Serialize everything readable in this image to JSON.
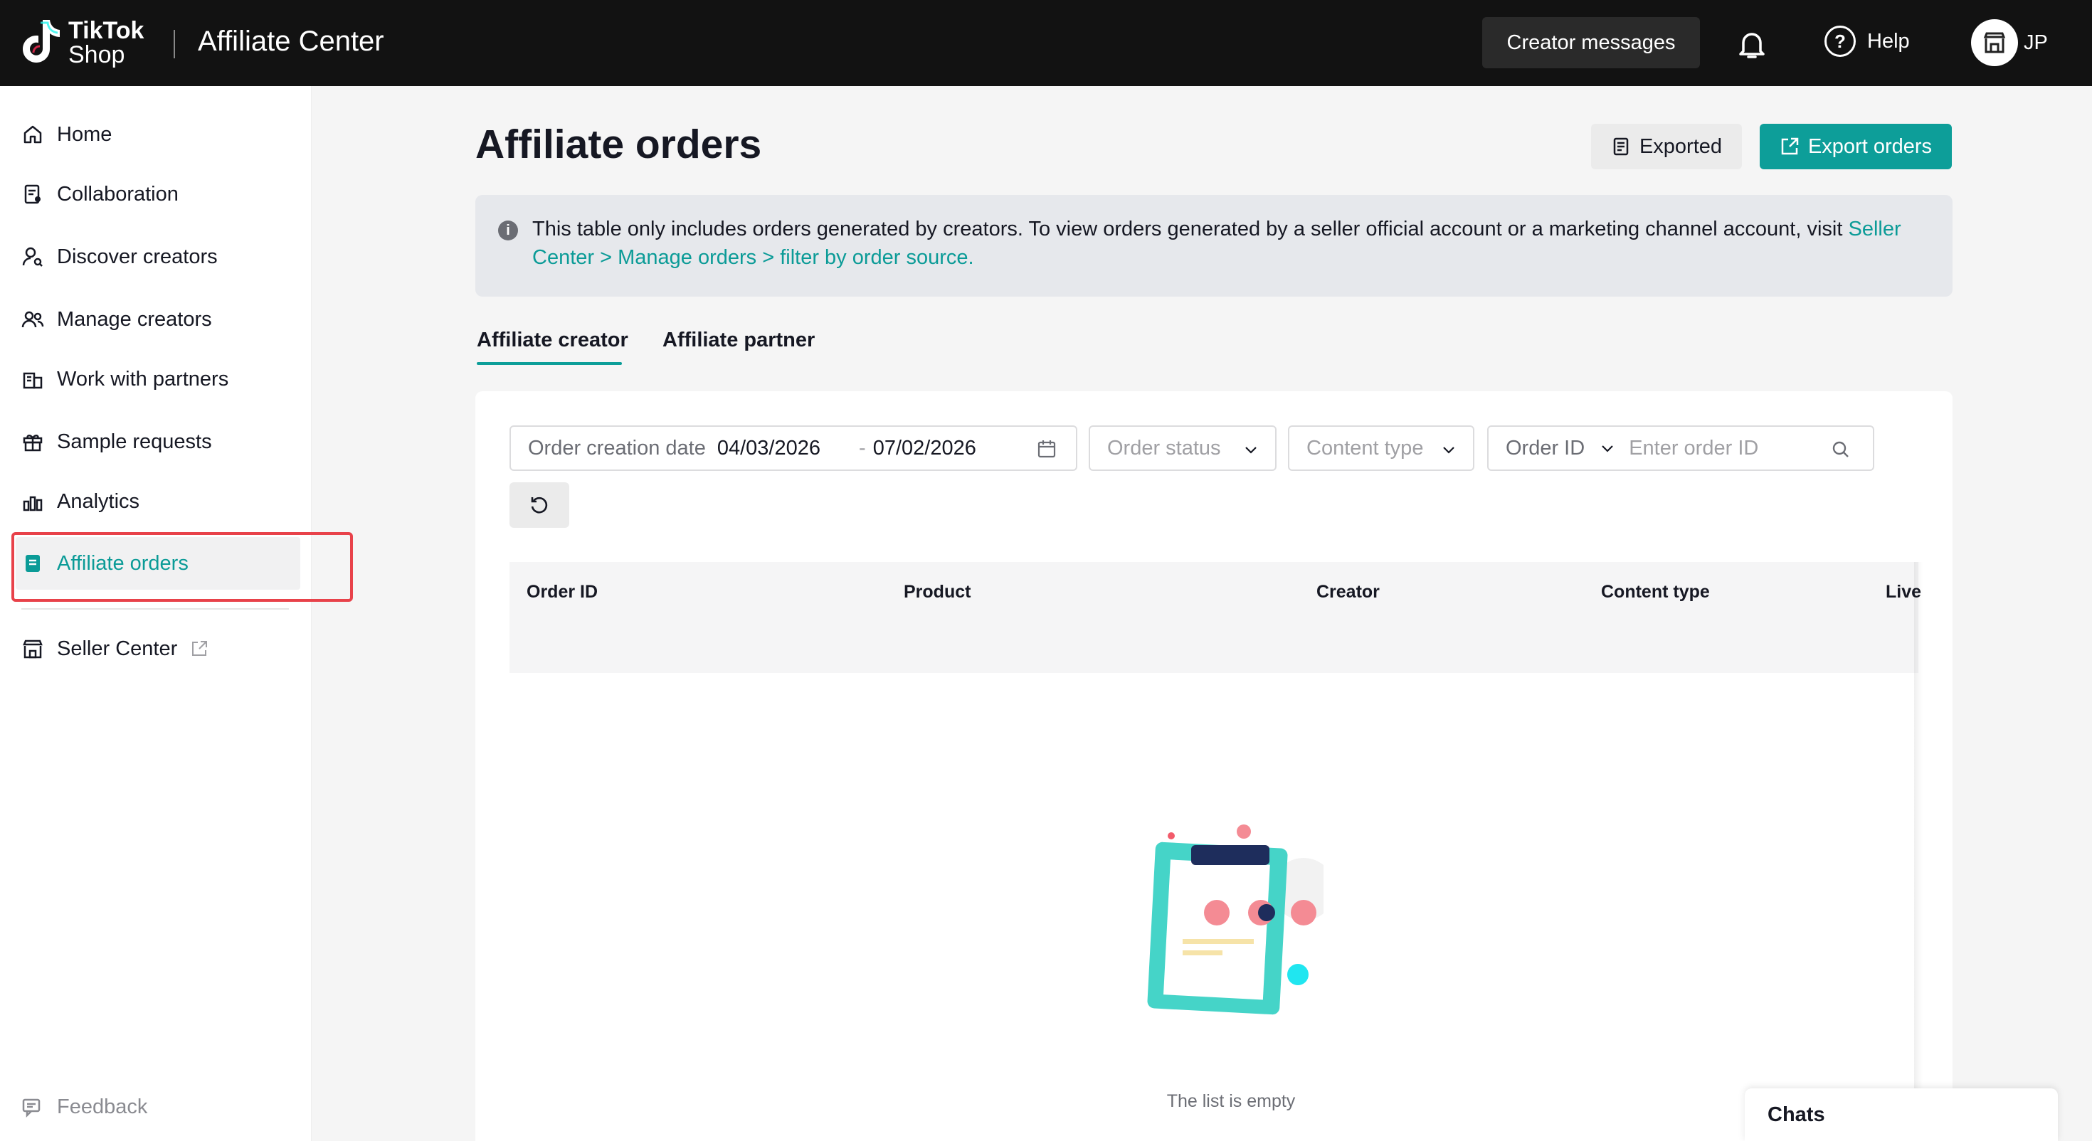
{
  "brand": {
    "logo_line1": "TikTok",
    "logo_line2": "Shop",
    "app_title": "Affiliate Center"
  },
  "header": {
    "creator_messages": "Creator messages",
    "help": "Help",
    "account_initials": "JP"
  },
  "sidebar": {
    "items": [
      {
        "label": "Home",
        "icon": "home-icon"
      },
      {
        "label": "Collaboration",
        "icon": "collaboration-icon"
      },
      {
        "label": "Discover creators",
        "icon": "discover-creators-icon"
      },
      {
        "label": "Manage creators",
        "icon": "manage-creators-icon"
      },
      {
        "label": "Work with partners",
        "icon": "partners-icon"
      },
      {
        "label": "Sample requests",
        "icon": "gift-icon"
      },
      {
        "label": "Analytics",
        "icon": "analytics-icon"
      },
      {
        "label": "Affiliate orders",
        "icon": "orders-icon",
        "active": true
      }
    ],
    "seller_center": "Seller Center",
    "feedback": "Feedback"
  },
  "page": {
    "title": "Affiliate orders",
    "exported_label": "Exported",
    "export_label": "Export orders",
    "info_text": "This table only includes orders generated by creators. To view orders generated by a seller official account or a marketing channel account, visit ",
    "info_link": "Seller Center > Manage orders > filter by order source.",
    "tabs": [
      "Affiliate creator",
      "Affiliate partner"
    ]
  },
  "filters": {
    "date_label": "Order creation date",
    "date_start": "04/03/2026",
    "date_sep": "-",
    "date_end": "07/02/2026",
    "order_status_placeholder": "Order status",
    "content_type_placeholder": "Content type",
    "order_id_label": "Order ID",
    "order_id_placeholder": "Enter order ID"
  },
  "table": {
    "columns": [
      "Order ID",
      "Product",
      "Creator",
      "Content type",
      "Live"
    ],
    "empty_text": "The list is empty"
  },
  "chats": {
    "label": "Chats"
  },
  "colors": {
    "accent": "#0d9e99",
    "highlight": "#e8424a",
    "topbar": "#121212"
  }
}
